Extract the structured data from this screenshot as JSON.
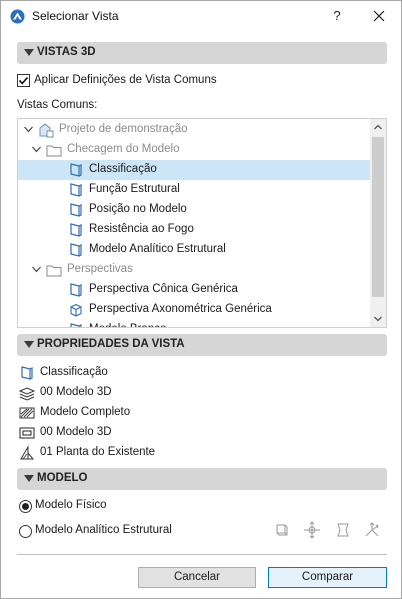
{
  "window": {
    "title": "Selecionar Vista",
    "help_label": "?"
  },
  "sections": {
    "views3d": "VISTAS 3D",
    "properties": "PROPRIEDADES DA VISTA",
    "model": "MODELO"
  },
  "apply_common": {
    "label": "Aplicar Definições de Vista Comuns",
    "checked": true
  },
  "common_views_label": "Vistas Comuns:",
  "tree": {
    "items": [
      {
        "label": "Projeto de demonstração",
        "level": 0,
        "kind": "project",
        "expanded": true
      },
      {
        "label": "Checagem do Modelo",
        "level": 1,
        "kind": "folder",
        "expanded": true
      },
      {
        "label": "Classificação",
        "level": 2,
        "kind": "view",
        "selected": true
      },
      {
        "label": "Função Estrutural",
        "level": 2,
        "kind": "view"
      },
      {
        "label": "Posição no Modelo",
        "level": 2,
        "kind": "view"
      },
      {
        "label": "Resistência ao Fogo",
        "level": 2,
        "kind": "view"
      },
      {
        "label": "Modelo Analítico Estrutural",
        "level": 2,
        "kind": "view"
      },
      {
        "label": "Perspectivas",
        "level": 1,
        "kind": "folder",
        "expanded": true
      },
      {
        "label": "Perspectiva Cônica Genérica",
        "level": 2,
        "kind": "view"
      },
      {
        "label": "Perspectiva Axonométrica Genérica",
        "level": 2,
        "kind": "view-axo"
      },
      {
        "label": "Modelo Branco",
        "level": 2,
        "kind": "view"
      }
    ]
  },
  "properties": {
    "items": [
      {
        "label": "Classificação",
        "icon": "view-icon"
      },
      {
        "label": "00 Modelo 3D",
        "icon": "layer-combination-icon"
      },
      {
        "label": "Modelo Completo",
        "icon": "model-display-icon"
      },
      {
        "label": "00 Modelo 3D",
        "icon": "pen-set-icon"
      },
      {
        "label": "01 Planta do Existente",
        "icon": "renovation-filter-icon"
      }
    ]
  },
  "model": {
    "options": [
      {
        "label": "Modelo Físico",
        "selected": true
      },
      {
        "label": "Modelo Analítico Estrutural",
        "selected": false
      }
    ],
    "tools": [
      "analytical-member-icon",
      "analytical-node-icon",
      "analytical-surface-icon",
      "analytical-support-icon"
    ]
  },
  "buttons": {
    "cancel": "Cancelar",
    "compare": "Comparar"
  },
  "colors": {
    "section_bg": "#d6d6d6",
    "selection": "#cde6f7",
    "icon_blue": "#2f6db5",
    "primary_border": "#0078d7"
  }
}
